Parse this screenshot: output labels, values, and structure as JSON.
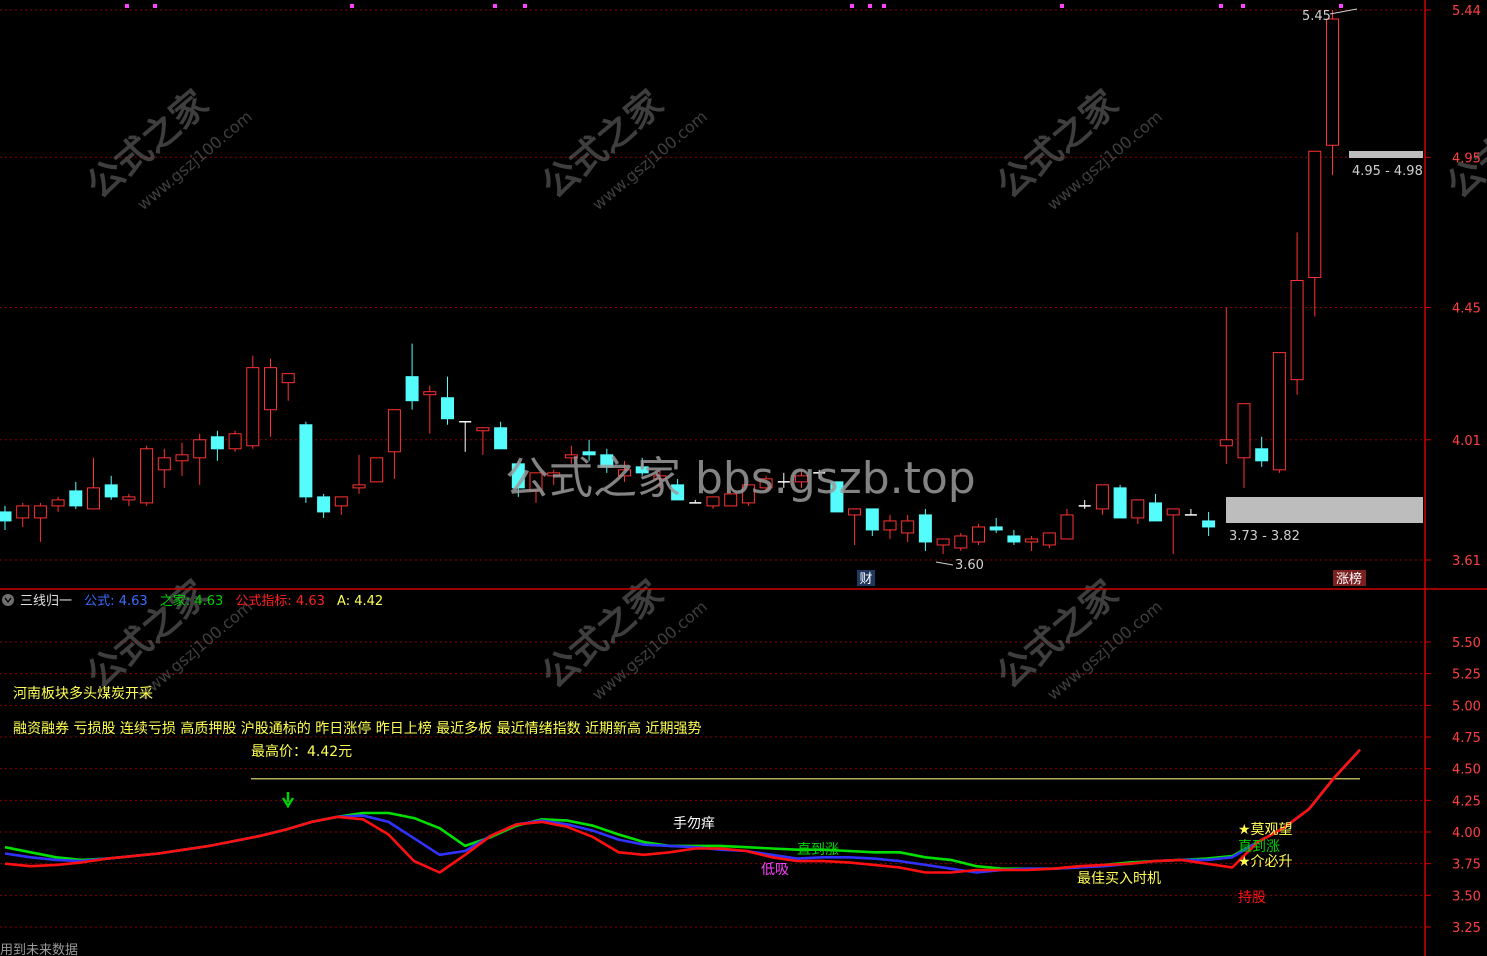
{
  "colors": {
    "bg": "#000000",
    "grid": "#8b0000",
    "axis": "#d20000",
    "up": "#ff3232",
    "down": "#54fcfc",
    "label": "#ff4040",
    "yellow": "#ffff54",
    "white": "#ffffff",
    "blue": "#3232ff",
    "green": "#00e000",
    "red": "#ff1010",
    "magenta": "#ff40ff",
    "grey": "#a0a0a0"
  },
  "header": {
    "title": "三线归一",
    "series_labels": [
      {
        "name": "公式",
        "value": "4.63",
        "color": "#3a6cff"
      },
      {
        "name": "之家",
        "value": "4.63",
        "color": "#00d000"
      },
      {
        "name": "公式指标",
        "value": "4.63",
        "color": "#ff2020"
      },
      {
        "name": "A",
        "value": "4.42",
        "color": "#ffff54"
      }
    ]
  },
  "texts": {
    "region_line": "河南板块多头煤炭开采",
    "tags_line": "融资融券 亏损股 连续亏损 高质押股 沪股通标的 昨日涨停 昨日上榜 最近多板 最近情绪指数 近期新高 近期强势",
    "max_price": "最高价：4.42元",
    "bottom_note": "用到未来数据",
    "watermark_center": "公式之家 bbs.gszb.top",
    "watermark_cn": "公式之家",
    "watermark_url": "www.gszj100.com"
  },
  "price_annotations": {
    "high": "5.45",
    "zone_top": "4.95 - 4.98",
    "zone_bottom": "3.73 - 3.82",
    "low": "3.60",
    "cai_badge": "财",
    "zhangbang_badge": "涨榜"
  },
  "signals": {
    "shou_wu_yang": "手勿痒",
    "di_xi": "低吸",
    "zhi_dao_zhang_1": "直到涨",
    "zui_jia": "最佳买入时机",
    "mo_guan_wang": "★莫观望",
    "zhi_dao_zhang_2": "直到涨",
    "jie_bi_sheng": "★介必升",
    "chi_gu": "持股"
  },
  "chart_data": [
    {
      "type": "candlestick",
      "yaxis_ticks": [
        "5.44",
        "4.95",
        "4.45",
        "4.01",
        "3.61"
      ],
      "ylim": [
        3.56,
        5.47
      ],
      "grid": true,
      "candles": [
        [
          3.77,
          3.79,
          3.71,
          3.74
        ],
        [
          3.75,
          3.8,
          3.72,
          3.79
        ],
        [
          3.75,
          3.8,
          3.67,
          3.79
        ],
        [
          3.79,
          3.82,
          3.77,
          3.81
        ],
        [
          3.84,
          3.87,
          3.78,
          3.79
        ],
        [
          3.78,
          3.95,
          3.78,
          3.85
        ],
        [
          3.86,
          3.89,
          3.81,
          3.82
        ],
        [
          3.81,
          3.83,
          3.79,
          3.82
        ],
        [
          3.8,
          3.99,
          3.79,
          3.98
        ],
        [
          3.91,
          3.98,
          3.85,
          3.95
        ],
        [
          3.94,
          4.0,
          3.89,
          3.96
        ],
        [
          3.95,
          4.03,
          3.86,
          4.01
        ],
        [
          4.02,
          4.04,
          3.94,
          3.98
        ],
        [
          3.98,
          4.04,
          3.97,
          4.03
        ],
        [
          3.99,
          4.29,
          3.98,
          4.25
        ],
        [
          4.11,
          4.28,
          4.02,
          4.25
        ],
        [
          4.2,
          4.23,
          4.14,
          4.23
        ],
        [
          4.06,
          4.07,
          3.8,
          3.82
        ],
        [
          3.82,
          3.83,
          3.75,
          3.77
        ],
        [
          3.79,
          3.82,
          3.76,
          3.82
        ],
        [
          3.85,
          3.96,
          3.83,
          3.86
        ],
        [
          3.87,
          3.95,
          3.87,
          3.95
        ],
        [
          3.97,
          4.1,
          3.88,
          4.11
        ],
        [
          4.22,
          4.33,
          4.11,
          4.14
        ],
        [
          4.16,
          4.19,
          4.03,
          4.17
        ],
        [
          4.15,
          4.22,
          4.06,
          4.08
        ],
        [
          4.07,
          4.07,
          3.97,
          4.07
        ],
        [
          4.04,
          4.04,
          3.96,
          4.05
        ],
        [
          4.05,
          4.07,
          3.99,
          3.98
        ],
        [
          3.93,
          3.94,
          3.82,
          3.85
        ],
        [
          3.84,
          3.9,
          3.8,
          3.9
        ],
        [
          3.89,
          3.91,
          3.86,
          3.9
        ],
        [
          3.95,
          3.99,
          3.93,
          3.96
        ],
        [
          3.97,
          4.01,
          3.94,
          3.96
        ],
        [
          3.96,
          3.98,
          3.9,
          3.92
        ],
        [
          3.89,
          3.94,
          3.87,
          3.91
        ],
        [
          3.92,
          3.95,
          3.89,
          3.9
        ],
        [
          3.88,
          3.91,
          3.85,
          3.89
        ],
        [
          3.86,
          3.88,
          3.81,
          3.81
        ],
        [
          3.8,
          3.81,
          3.8,
          3.8
        ],
        [
          3.79,
          3.82,
          3.78,
          3.82
        ],
        [
          3.79,
          3.83,
          3.79,
          3.83
        ],
        [
          3.8,
          3.86,
          3.79,
          3.86
        ],
        [
          3.85,
          3.89,
          3.84,
          3.88
        ],
        [
          3.87,
          3.9,
          3.85,
          3.87
        ],
        [
          3.87,
          3.91,
          3.85,
          3.89
        ],
        [
          3.9,
          3.91,
          3.88,
          3.9
        ],
        [
          3.87,
          3.87,
          3.77,
          3.77
        ],
        [
          3.76,
          3.78,
          3.66,
          3.78
        ],
        [
          3.78,
          3.78,
          3.69,
          3.71
        ],
        [
          3.71,
          3.76,
          3.68,
          3.74
        ],
        [
          3.7,
          3.76,
          3.67,
          3.74
        ],
        [
          3.76,
          3.78,
          3.64,
          3.67
        ],
        [
          3.66,
          3.68,
          3.63,
          3.68
        ],
        [
          3.65,
          3.7,
          3.64,
          3.69
        ],
        [
          3.67,
          3.73,
          3.66,
          3.72
        ],
        [
          3.72,
          3.75,
          3.7,
          3.71
        ],
        [
          3.69,
          3.71,
          3.66,
          3.67
        ],
        [
          3.67,
          3.69,
          3.64,
          3.68
        ],
        [
          3.66,
          3.7,
          3.65,
          3.7
        ],
        [
          3.68,
          3.78,
          3.68,
          3.76
        ],
        [
          3.79,
          3.81,
          3.78,
          3.79
        ],
        [
          3.78,
          3.86,
          3.76,
          3.86
        ],
        [
          3.85,
          3.86,
          3.75,
          3.75
        ],
        [
          3.75,
          3.81,
          3.73,
          3.81
        ],
        [
          3.8,
          3.83,
          3.74,
          3.74
        ],
        [
          3.76,
          3.78,
          3.63,
          3.78
        ],
        [
          3.76,
          3.78,
          3.76,
          3.76
        ],
        [
          3.74,
          3.77,
          3.69,
          3.72
        ],
        [
          3.99,
          4.45,
          3.93,
          4.01
        ],
        [
          3.95,
          4.04,
          3.85,
          4.13
        ],
        [
          3.98,
          4.02,
          3.92,
          3.94
        ],
        [
          3.91,
          4.26,
          3.9,
          4.3
        ],
        [
          4.21,
          4.7,
          4.16,
          4.54
        ],
        [
          4.55,
          4.94,
          4.42,
          4.97
        ],
        [
          4.99,
          5.44,
          4.89,
          5.41
        ]
      ]
    },
    {
      "type": "line",
      "title": "三线归一",
      "yaxis_ticks": [
        "5.50",
        "5.25",
        "5.00",
        "4.75",
        "4.50",
        "4.25",
        "4.00",
        "3.75",
        "3.50",
        "3.25"
      ],
      "ylim": [
        3.12,
        5.85
      ],
      "grid": true,
      "reference_line": 4.42,
      "series": [
        {
          "name": "之家",
          "color": "#00e000",
          "values": [
            3.88,
            3.84,
            3.8,
            3.78,
            3.79,
            3.81,
            3.83,
            3.86,
            3.89,
            3.93,
            3.97,
            4.02,
            4.08,
            4.12,
            4.15,
            4.15,
            4.11,
            4.03,
            3.89,
            3.96,
            4.05,
            4.1,
            4.09,
            4.05,
            3.98,
            3.92,
            3.89,
            3.89,
            3.89,
            3.88,
            3.87,
            3.86,
            3.86,
            3.85,
            3.84,
            3.84,
            3.8,
            3.78,
            3.73,
            3.71,
            3.71,
            3.71,
            3.72,
            3.74,
            3.76,
            3.77,
            3.78,
            3.79,
            3.81,
            3.92,
            4.03,
            4.18,
            4.43,
            4.65
          ]
        },
        {
          "name": "公式",
          "color": "#3232ff",
          "values": [
            3.83,
            3.8,
            3.78,
            3.77,
            3.79,
            3.81,
            3.83,
            3.86,
            3.89,
            3.93,
            3.97,
            4.02,
            4.08,
            4.12,
            4.13,
            4.08,
            3.95,
            3.82,
            3.85,
            3.97,
            4.06,
            4.09,
            4.06,
            4.01,
            3.94,
            3.9,
            3.89,
            3.88,
            3.86,
            3.85,
            3.82,
            3.79,
            3.8,
            3.8,
            3.79,
            3.77,
            3.74,
            3.71,
            3.68,
            3.7,
            3.71,
            3.71,
            3.72,
            3.73,
            3.75,
            3.77,
            3.78,
            3.78,
            3.8,
            3.92,
            4.03,
            4.18,
            4.43,
            4.65
          ]
        },
        {
          "name": "公式指标",
          "color": "#ff1010",
          "values": [
            3.75,
            3.73,
            3.74,
            3.76,
            3.79,
            3.81,
            3.83,
            3.86,
            3.89,
            3.93,
            3.97,
            4.02,
            4.08,
            4.12,
            4.1,
            3.98,
            3.77,
            3.68,
            3.82,
            3.97,
            4.06,
            4.08,
            4.04,
            3.96,
            3.84,
            3.82,
            3.84,
            3.87,
            3.87,
            3.85,
            3.8,
            3.77,
            3.77,
            3.76,
            3.74,
            3.72,
            3.68,
            3.68,
            3.7,
            3.7,
            3.7,
            3.71,
            3.73,
            3.74,
            3.75,
            3.77,
            3.78,
            3.75,
            3.72,
            3.92,
            4.03,
            4.18,
            4.43,
            4.65
          ]
        }
      ]
    }
  ]
}
